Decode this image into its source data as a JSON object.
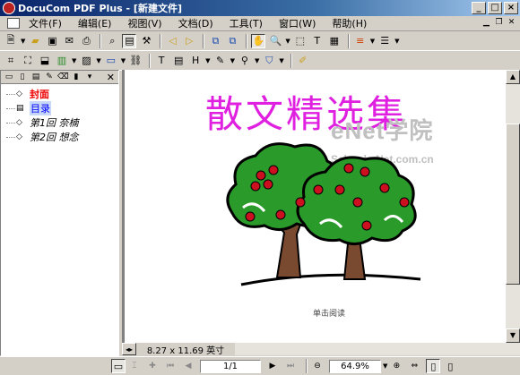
{
  "window": {
    "title": "DocuCom PDF Plus - [新建文件]",
    "buttons": [
      "_",
      "□",
      "×"
    ]
  },
  "menu": [
    "文件(F)",
    "编辑(E)",
    "视图(V)",
    "文档(D)",
    "工具(T)",
    "窗口(W)",
    "帮助(H)"
  ],
  "bookmarks": [
    {
      "label": "封面",
      "style": "cover"
    },
    {
      "label": "目录",
      "style": "toc"
    },
    {
      "label": "第1回 奈楠",
      "style": "it"
    },
    {
      "label": "第2回 想念",
      "style": "it"
    }
  ],
  "page": {
    "title": "散文精选集",
    "watermark_line1": "eNet学院",
    "watermark_line2": "School.eNet.com.cn",
    "caption": "单击阅读"
  },
  "page_size": "8.27 x 11.69 英寸",
  "status": {
    "page": "1/1",
    "zoom": "64.9%"
  },
  "colors": {
    "title": "#e020e0",
    "tree_green": "#2a9a2a",
    "trunk": "#7a4a30",
    "apple": "#cc1020"
  }
}
